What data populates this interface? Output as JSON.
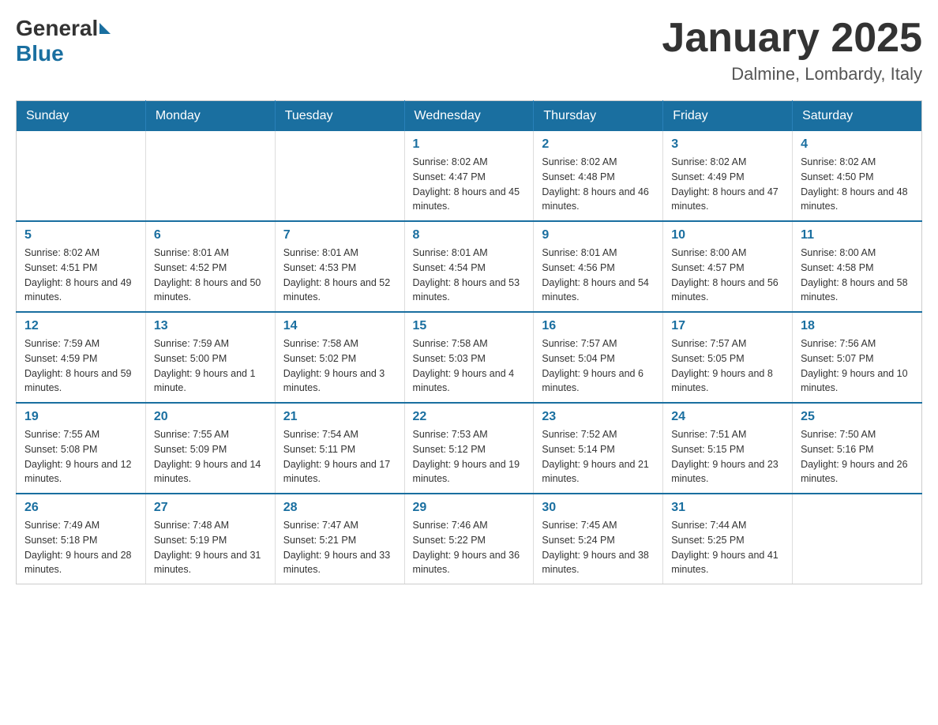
{
  "header": {
    "logo": {
      "general": "General",
      "blue": "Blue"
    },
    "title": "January 2025",
    "location": "Dalmine, Lombardy, Italy"
  },
  "days_of_week": [
    "Sunday",
    "Monday",
    "Tuesday",
    "Wednesday",
    "Thursday",
    "Friday",
    "Saturday"
  ],
  "weeks": [
    [
      {
        "day": null
      },
      {
        "day": null
      },
      {
        "day": null
      },
      {
        "day": "1",
        "sunrise": "Sunrise: 8:02 AM",
        "sunset": "Sunset: 4:47 PM",
        "daylight": "Daylight: 8 hours and 45 minutes."
      },
      {
        "day": "2",
        "sunrise": "Sunrise: 8:02 AM",
        "sunset": "Sunset: 4:48 PM",
        "daylight": "Daylight: 8 hours and 46 minutes."
      },
      {
        "day": "3",
        "sunrise": "Sunrise: 8:02 AM",
        "sunset": "Sunset: 4:49 PM",
        "daylight": "Daylight: 8 hours and 47 minutes."
      },
      {
        "day": "4",
        "sunrise": "Sunrise: 8:02 AM",
        "sunset": "Sunset: 4:50 PM",
        "daylight": "Daylight: 8 hours and 48 minutes."
      }
    ],
    [
      {
        "day": "5",
        "sunrise": "Sunrise: 8:02 AM",
        "sunset": "Sunset: 4:51 PM",
        "daylight": "Daylight: 8 hours and 49 minutes."
      },
      {
        "day": "6",
        "sunrise": "Sunrise: 8:01 AM",
        "sunset": "Sunset: 4:52 PM",
        "daylight": "Daylight: 8 hours and 50 minutes."
      },
      {
        "day": "7",
        "sunrise": "Sunrise: 8:01 AM",
        "sunset": "Sunset: 4:53 PM",
        "daylight": "Daylight: 8 hours and 52 minutes."
      },
      {
        "day": "8",
        "sunrise": "Sunrise: 8:01 AM",
        "sunset": "Sunset: 4:54 PM",
        "daylight": "Daylight: 8 hours and 53 minutes."
      },
      {
        "day": "9",
        "sunrise": "Sunrise: 8:01 AM",
        "sunset": "Sunset: 4:56 PM",
        "daylight": "Daylight: 8 hours and 54 minutes."
      },
      {
        "day": "10",
        "sunrise": "Sunrise: 8:00 AM",
        "sunset": "Sunset: 4:57 PM",
        "daylight": "Daylight: 8 hours and 56 minutes."
      },
      {
        "day": "11",
        "sunrise": "Sunrise: 8:00 AM",
        "sunset": "Sunset: 4:58 PM",
        "daylight": "Daylight: 8 hours and 58 minutes."
      }
    ],
    [
      {
        "day": "12",
        "sunrise": "Sunrise: 7:59 AM",
        "sunset": "Sunset: 4:59 PM",
        "daylight": "Daylight: 8 hours and 59 minutes."
      },
      {
        "day": "13",
        "sunrise": "Sunrise: 7:59 AM",
        "sunset": "Sunset: 5:00 PM",
        "daylight": "Daylight: 9 hours and 1 minute."
      },
      {
        "day": "14",
        "sunrise": "Sunrise: 7:58 AM",
        "sunset": "Sunset: 5:02 PM",
        "daylight": "Daylight: 9 hours and 3 minutes."
      },
      {
        "day": "15",
        "sunrise": "Sunrise: 7:58 AM",
        "sunset": "Sunset: 5:03 PM",
        "daylight": "Daylight: 9 hours and 4 minutes."
      },
      {
        "day": "16",
        "sunrise": "Sunrise: 7:57 AM",
        "sunset": "Sunset: 5:04 PM",
        "daylight": "Daylight: 9 hours and 6 minutes."
      },
      {
        "day": "17",
        "sunrise": "Sunrise: 7:57 AM",
        "sunset": "Sunset: 5:05 PM",
        "daylight": "Daylight: 9 hours and 8 minutes."
      },
      {
        "day": "18",
        "sunrise": "Sunrise: 7:56 AM",
        "sunset": "Sunset: 5:07 PM",
        "daylight": "Daylight: 9 hours and 10 minutes."
      }
    ],
    [
      {
        "day": "19",
        "sunrise": "Sunrise: 7:55 AM",
        "sunset": "Sunset: 5:08 PM",
        "daylight": "Daylight: 9 hours and 12 minutes."
      },
      {
        "day": "20",
        "sunrise": "Sunrise: 7:55 AM",
        "sunset": "Sunset: 5:09 PM",
        "daylight": "Daylight: 9 hours and 14 minutes."
      },
      {
        "day": "21",
        "sunrise": "Sunrise: 7:54 AM",
        "sunset": "Sunset: 5:11 PM",
        "daylight": "Daylight: 9 hours and 17 minutes."
      },
      {
        "day": "22",
        "sunrise": "Sunrise: 7:53 AM",
        "sunset": "Sunset: 5:12 PM",
        "daylight": "Daylight: 9 hours and 19 minutes."
      },
      {
        "day": "23",
        "sunrise": "Sunrise: 7:52 AM",
        "sunset": "Sunset: 5:14 PM",
        "daylight": "Daylight: 9 hours and 21 minutes."
      },
      {
        "day": "24",
        "sunrise": "Sunrise: 7:51 AM",
        "sunset": "Sunset: 5:15 PM",
        "daylight": "Daylight: 9 hours and 23 minutes."
      },
      {
        "day": "25",
        "sunrise": "Sunrise: 7:50 AM",
        "sunset": "Sunset: 5:16 PM",
        "daylight": "Daylight: 9 hours and 26 minutes."
      }
    ],
    [
      {
        "day": "26",
        "sunrise": "Sunrise: 7:49 AM",
        "sunset": "Sunset: 5:18 PM",
        "daylight": "Daylight: 9 hours and 28 minutes."
      },
      {
        "day": "27",
        "sunrise": "Sunrise: 7:48 AM",
        "sunset": "Sunset: 5:19 PM",
        "daylight": "Daylight: 9 hours and 31 minutes."
      },
      {
        "day": "28",
        "sunrise": "Sunrise: 7:47 AM",
        "sunset": "Sunset: 5:21 PM",
        "daylight": "Daylight: 9 hours and 33 minutes."
      },
      {
        "day": "29",
        "sunrise": "Sunrise: 7:46 AM",
        "sunset": "Sunset: 5:22 PM",
        "daylight": "Daylight: 9 hours and 36 minutes."
      },
      {
        "day": "30",
        "sunrise": "Sunrise: 7:45 AM",
        "sunset": "Sunset: 5:24 PM",
        "daylight": "Daylight: 9 hours and 38 minutes."
      },
      {
        "day": "31",
        "sunrise": "Sunrise: 7:44 AM",
        "sunset": "Sunset: 5:25 PM",
        "daylight": "Daylight: 9 hours and 41 minutes."
      },
      {
        "day": null
      }
    ]
  ]
}
